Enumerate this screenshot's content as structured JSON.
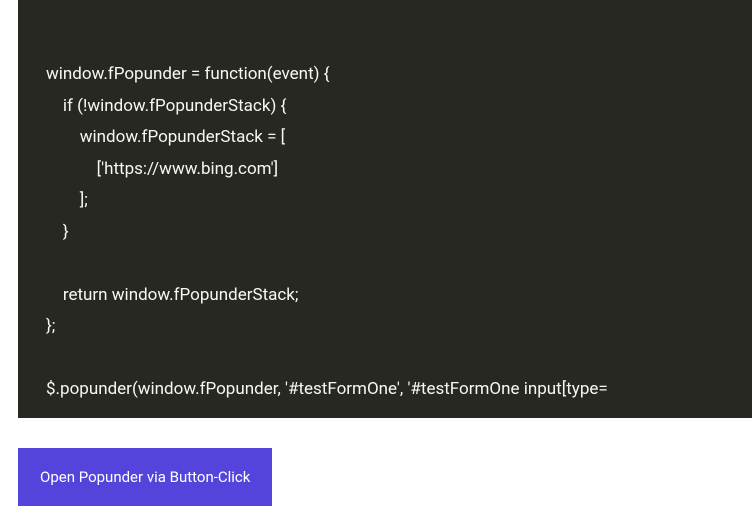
{
  "code": {
    "content": "\nwindow.fPopunder = function(event) {\n    if (!window.fPopunderStack) {\n        window.fPopunderStack = [\n            ['https://www.bing.com']\n        ];\n    }\n\n    return window.fPopunderStack;\n};\n\n$.popunder(window.fPopunder, '#testFormOne', '#testFormOne input[type="
  },
  "button": {
    "label": "Open Popunder via Button-Click"
  }
}
